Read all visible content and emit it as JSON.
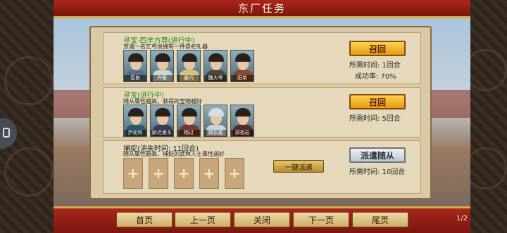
{
  "window": {
    "title": "东厂任务"
  },
  "tasks": [
    {
      "name": "寻宝-四羊方尊(进行中)",
      "desc": "京城一名乞丐说拥有一件祭祀礼器",
      "members": [
        "袁良",
        "许衡",
        "姜巧",
        "魏大爷",
        "田单"
      ],
      "button": "召回",
      "time": "所需时间: 1回合",
      "rate": "成功率: 70%"
    },
    {
      "name": "寻宝(进行中)",
      "desc": "随从属性越高，获得的宝物越好",
      "members": [
        "尹初伶",
        "尉迟景东",
        "杨过",
        "韩钦霜",
        "郑祖岩"
      ],
      "button": "召回",
      "time": "所需时间: 5回合"
    },
    {
      "name": "捕捉(消失时间: 11回合)",
      "desc": "随从属性越高，捕捉的武林人士属性越好",
      "button": "派遣随从",
      "time": "所需时间: 10回合",
      "onekey": "一键派遣"
    }
  ],
  "nav": {
    "first": "首页",
    "prev": "上一页",
    "close": "关闭",
    "next": "下一页",
    "last": "尾页",
    "page": "1/2"
  },
  "colors": {
    "accent": "#a8261c",
    "gold": "#d6a94a",
    "task_green": "#2e8a18"
  },
  "icons": [
    "plus-icon",
    "lock-icon"
  ]
}
